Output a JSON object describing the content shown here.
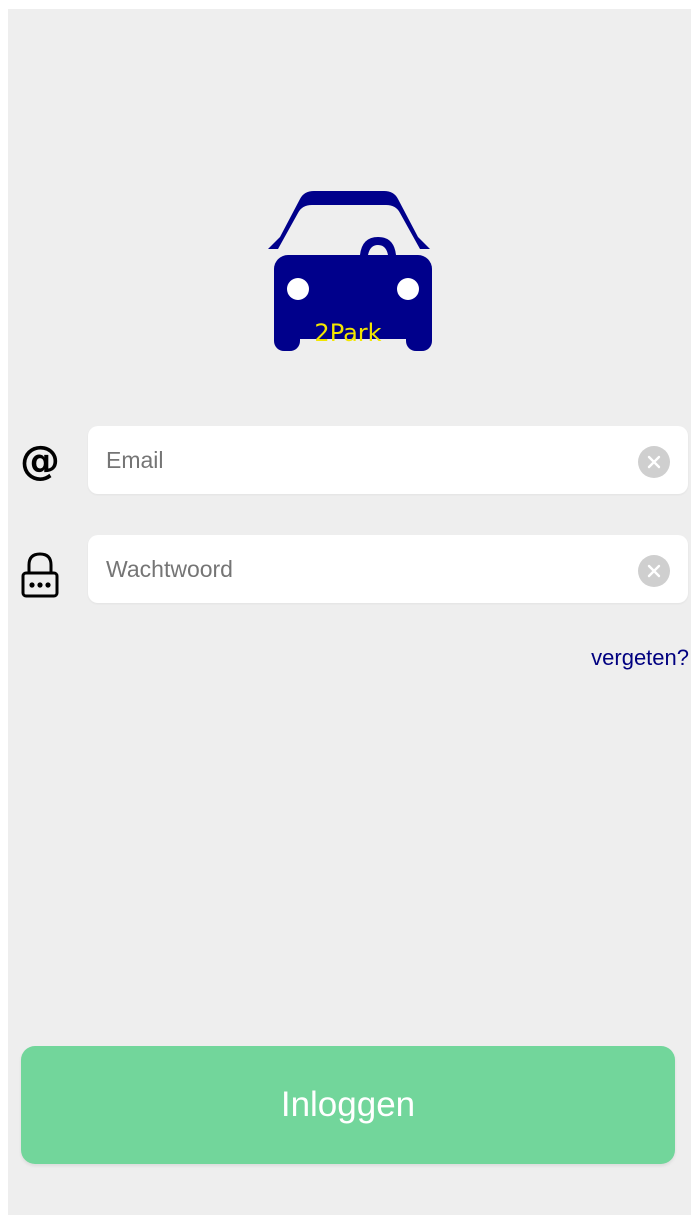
{
  "logo": {
    "text": "2Park",
    "car_color": "#00008b",
    "text_color": "#f2e600"
  },
  "email": {
    "icon": "at-icon",
    "placeholder": "Email",
    "value": ""
  },
  "password": {
    "icon": "lock-icon",
    "placeholder": "Wachtwoord",
    "value": ""
  },
  "forgot_link": "vergeten?",
  "login_button": "Inloggen",
  "colors": {
    "background": "#eeeeee",
    "accent": "#72d69b",
    "link": "#000080"
  }
}
